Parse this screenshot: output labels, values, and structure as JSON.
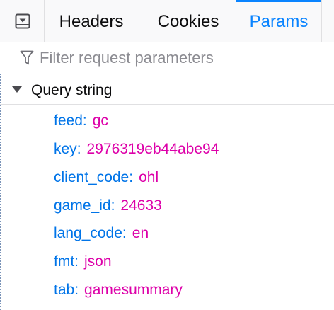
{
  "tabs": [
    {
      "label": "Headers",
      "active": false
    },
    {
      "label": "Cookies",
      "active": false
    },
    {
      "label": "Params",
      "active": true
    }
  ],
  "toggle": {
    "icon": "sidebar-toggle-icon"
  },
  "filter": {
    "icon": "funnel-icon",
    "placeholder": "Filter request parameters",
    "value": ""
  },
  "section": {
    "title": "Query string",
    "expanded": true
  },
  "params": [
    {
      "key": "feed",
      "value": "gc"
    },
    {
      "key": "key",
      "value": "2976319eb44abe94"
    },
    {
      "key": "client_code",
      "value": "ohl"
    },
    {
      "key": "game_id",
      "value": "24633"
    },
    {
      "key": "lang_code",
      "value": "en"
    },
    {
      "key": "fmt",
      "value": "json"
    },
    {
      "key": "tab",
      "value": "gamesummary"
    }
  ],
  "colors": {
    "accent": "#0a84ff",
    "key": "#0074e8",
    "value": "#dd00a9"
  }
}
